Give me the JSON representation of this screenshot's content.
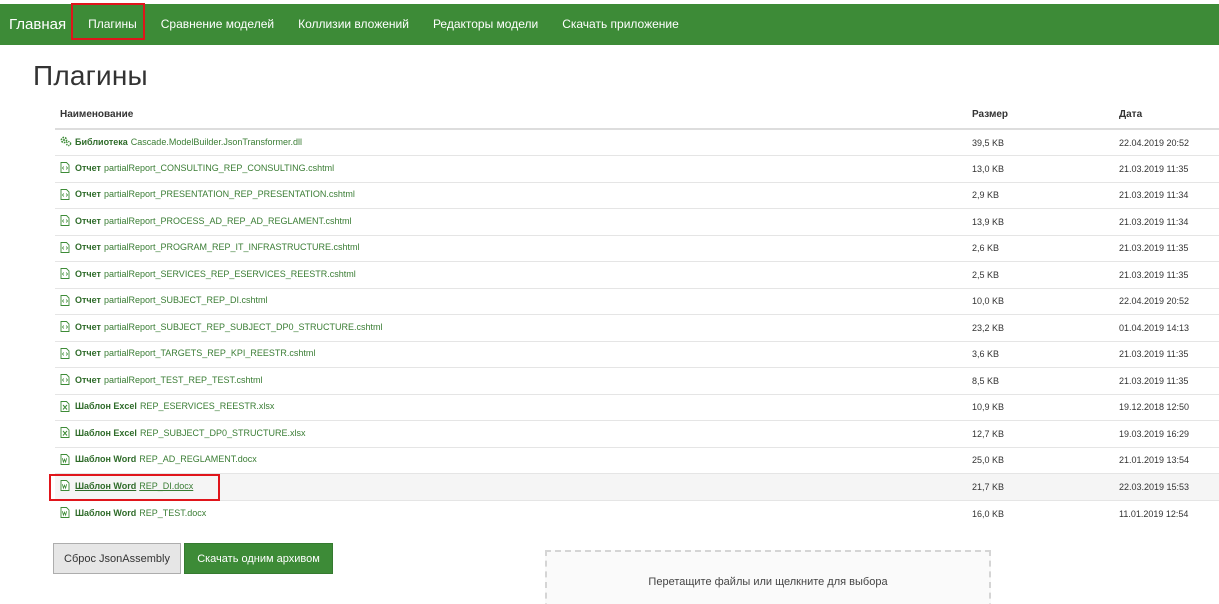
{
  "nav": {
    "brand": "Главная",
    "items": [
      {
        "label": "Плагины"
      },
      {
        "label": "Сравнение моделей"
      },
      {
        "label": "Коллизии вложений"
      },
      {
        "label": "Редакторы модели"
      },
      {
        "label": "Скачать приложение"
      }
    ]
  },
  "page": {
    "title": "Плагины"
  },
  "table": {
    "headers": {
      "name": "Наименование",
      "size": "Размер",
      "date": "Дата"
    },
    "rows": [
      {
        "icon": "gears-icon",
        "type": "Библиотека",
        "name": "Cascade.ModelBuilder.JsonTransformer.dll",
        "size": "39,5 KB",
        "date": "22.04.2019 20:52"
      },
      {
        "icon": "code-file-icon",
        "type": "Отчет",
        "name": "partialReport_CONSULTING_REP_CONSULTING.cshtml",
        "size": "13,0 KB",
        "date": "21.03.2019 11:35"
      },
      {
        "icon": "code-file-icon",
        "type": "Отчет",
        "name": "partialReport_PRESENTATION_REP_PRESENTATION.cshtml",
        "size": "2,9 KB",
        "date": "21.03.2019 11:34"
      },
      {
        "icon": "code-file-icon",
        "type": "Отчет",
        "name": "partialReport_PROCESS_AD_REP_AD_REGLAMENT.cshtml",
        "size": "13,9 KB",
        "date": "21.03.2019 11:34"
      },
      {
        "icon": "code-file-icon",
        "type": "Отчет",
        "name": "partialReport_PROGRAM_REP_IT_INFRASTRUCTURE.cshtml",
        "size": "2,6 KB",
        "date": "21.03.2019 11:35"
      },
      {
        "icon": "code-file-icon",
        "type": "Отчет",
        "name": "partialReport_SERVICES_REP_ESERVICES_REESTR.cshtml",
        "size": "2,5 KB",
        "date": "21.03.2019 11:35"
      },
      {
        "icon": "code-file-icon",
        "type": "Отчет",
        "name": "partialReport_SUBJECT_REP_DI.cshtml",
        "size": "10,0 KB",
        "date": "22.04.2019 20:52"
      },
      {
        "icon": "code-file-icon",
        "type": "Отчет",
        "name": "partialReport_SUBJECT_REP_SUBJECT_DP0_STRUCTURE.cshtml",
        "size": "23,2 KB",
        "date": "01.04.2019 14:13"
      },
      {
        "icon": "code-file-icon",
        "type": "Отчет",
        "name": "partialReport_TARGETS_REP_KPI_REESTR.cshtml",
        "size": "3,6 KB",
        "date": "21.03.2019 11:35"
      },
      {
        "icon": "code-file-icon",
        "type": "Отчет",
        "name": "partialReport_TEST_REP_TEST.cshtml",
        "size": "8,5 KB",
        "date": "21.03.2019 11:35"
      },
      {
        "icon": "excel-file-icon",
        "type": "Шаблон Excel",
        "name": "REP_ESERVICES_REESTR.xlsx",
        "size": "10,9 KB",
        "date": "19.12.2018 12:50"
      },
      {
        "icon": "excel-file-icon",
        "type": "Шаблон Excel",
        "name": "REP_SUBJECT_DP0_STRUCTURE.xlsx",
        "size": "12,7 KB",
        "date": "19.03.2019 16:29"
      },
      {
        "icon": "word-file-icon",
        "type": "Шаблон Word",
        "name": "REP_AD_REGLAMENT.docx",
        "size": "25,0 KB",
        "date": "21.01.2019 13:54"
      },
      {
        "icon": "word-file-icon",
        "type": "Шаблон Word",
        "name": "REP_DI.docx",
        "size": "21,7 KB",
        "date": "22.03.2019 15:53"
      },
      {
        "icon": "word-file-icon",
        "type": "Шаблон Word",
        "name": "REP_TEST.docx",
        "size": "16,0 KB",
        "date": "11.01.2019 12:54"
      }
    ]
  },
  "actions": {
    "reset_label": "Сброс JsonAssembly",
    "download_label": "Скачать одним архивом"
  },
  "dropzone": {
    "text": "Перетащите файлы или щелкните для выбора"
  },
  "colors": {
    "navbar": "#3d8b37",
    "link": "#3a7d34",
    "highlight": "#e0151b"
  }
}
